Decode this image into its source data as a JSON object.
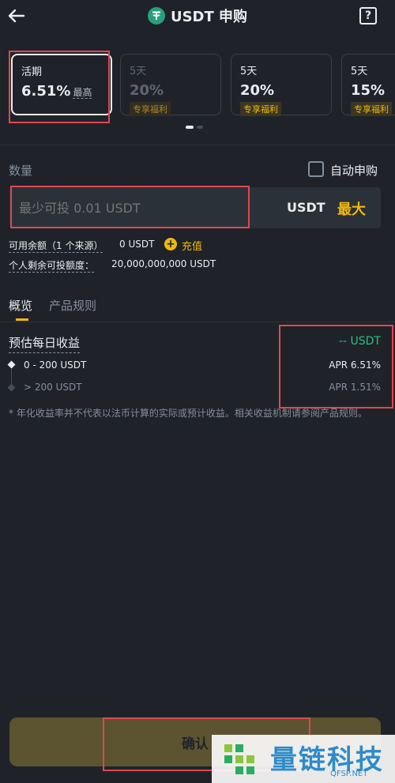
{
  "header": {
    "title": "USDT 申购"
  },
  "products": [
    {
      "term": "活期",
      "rate": "6.51%",
      "suffix": "最高",
      "tag": ""
    },
    {
      "term": "5天",
      "rate": "20%",
      "suffix": "",
      "tag": "专享福利"
    },
    {
      "term": "5天",
      "rate": "20%",
      "suffix": "",
      "tag": "专享福利"
    },
    {
      "term": "5天",
      "rate": "15%",
      "suffix": "",
      "tag": "专享福利"
    }
  ],
  "quantity": {
    "label": "数量",
    "auto_label": "自动申购",
    "placeholder": "最少可投 0.01 USDT",
    "unit": "USDT",
    "max_label": "最大"
  },
  "balance": {
    "available_label": "可用余额（1 个来源）",
    "available_value": "0 USDT",
    "deposit_label": "充值",
    "remaining_label": "个人剩余可投额度：",
    "remaining_value": "20,000,000,000 USDT"
  },
  "tabs": [
    {
      "label": "概览"
    },
    {
      "label": "产品规则"
    }
  ],
  "overview": {
    "est_label": "预估每日收益",
    "est_value": "-- USDT",
    "tiers": [
      {
        "range": "0 - 200 USDT",
        "apr": "APR 6.51%"
      },
      {
        "range": "> 200 USDT",
        "apr": "APR 1.51%"
      }
    ],
    "note": "* 年化收益率并不代表以法币计算的实际或预计收益。相关收益机制请参阅产品规则。"
  },
  "confirm_label": "确认",
  "watermark": {
    "title": "量链科技",
    "site": "QFSP.NET"
  },
  "colors": {
    "bg": "#1f2329",
    "accent": "#f0b90b",
    "green": "#2ebd85",
    "red_box": "#e0474f",
    "confirm_bg": "#5c5331"
  }
}
